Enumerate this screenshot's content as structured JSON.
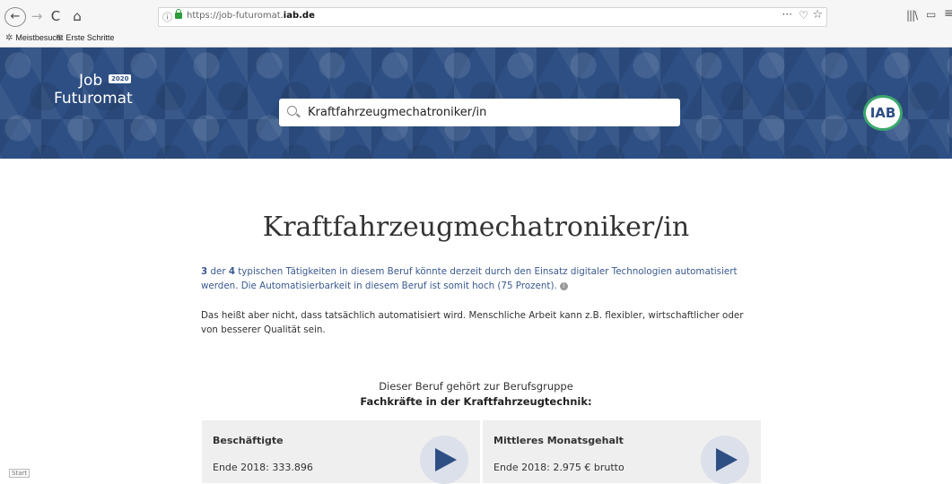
{
  "browser": {
    "url_host_prefix": "https://job-futuromat.",
    "url_host_domain": "iab.de",
    "bookmarks": [
      "Meistbesucht",
      "Erste Schritte"
    ],
    "more_label": "···",
    "back_symbol": "←",
    "forward_symbol": "→",
    "reload_symbol": "C",
    "home_symbol": "⌂"
  },
  "header": {
    "logo_job": "Job",
    "logo_year": "2020",
    "logo_name": "Futuromat",
    "search_value": "Kraftfahrzeugmechatroniker/in",
    "partner_logo": "IAB"
  },
  "main": {
    "title": "Kraftfahrzeugmechatroniker/in",
    "automation": {
      "count": "3",
      "text_a": " der ",
      "total": "4",
      "text_b": " typischen Tätigkeiten in diesem Beruf könnte derzeit durch den Einsatz digitaler Technologien automatisiert werden. Die Automatisierbarkeit in diesem Beruf ist somit hoch (75 Prozent)."
    },
    "note": "Das heißt aber nicht, dass tatsächlich automatisiert wird. Menschliche Arbeit kann z.B. flexibler, wirtschaftlicher oder von besserer Qualität sein.",
    "group_intro": "Dieser Beruf gehört zur Berufsgruppe",
    "group_name": "Fachkräfte in der Kraftfahrzeugtechnik:",
    "cards": [
      {
        "title": "Beschäftigte",
        "value": "Ende 2018: 333.896"
      },
      {
        "title": "Mittleres Monatsgehalt",
        "value": "Ende 2018: 2.975 € brutto"
      }
    ]
  },
  "footer": {
    "start_label": "Start"
  },
  "colors": {
    "banner": "#2e4f84",
    "link_text": "#3b5a8f",
    "iab_ring": "#3aa76d"
  }
}
